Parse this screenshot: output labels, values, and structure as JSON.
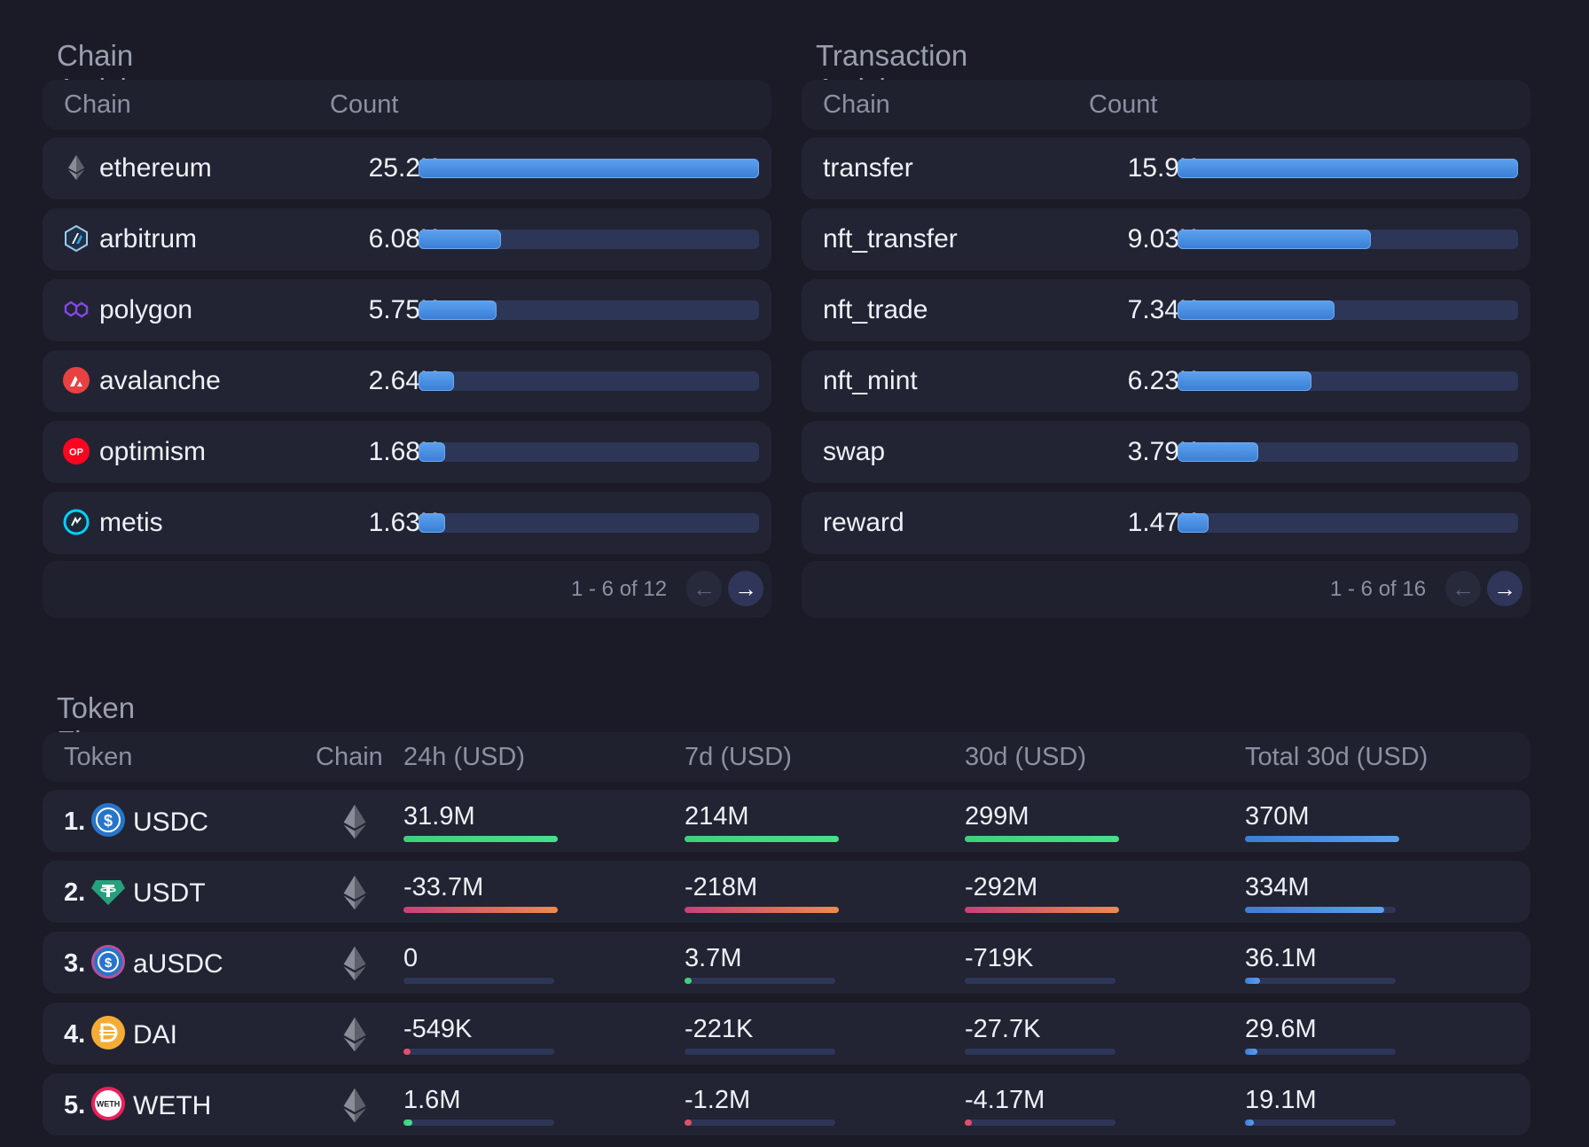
{
  "chain_activity": {
    "title": "Chain Activity",
    "headers": {
      "chain": "Chain",
      "count": "Count"
    },
    "rows": [
      {
        "name": "ethereum",
        "count": "25.2K",
        "share": 1.0,
        "icon": "ethereum-icon"
      },
      {
        "name": "arbitrum",
        "count": "6.08K",
        "share": 0.241,
        "icon": "arbitrum-icon"
      },
      {
        "name": "polygon",
        "count": "5.75K",
        "share": 0.228,
        "icon": "polygon-icon"
      },
      {
        "name": "avalanche",
        "count": "2.64K",
        "share": 0.105,
        "icon": "avalanche-icon"
      },
      {
        "name": "optimism",
        "count": "1.68K",
        "share": 0.067,
        "icon": "optimism-icon"
      },
      {
        "name": "metis",
        "count": "1.63K",
        "share": 0.065,
        "icon": "metis-icon"
      }
    ],
    "pagination": "1 - 6 of 12"
  },
  "transaction_activity": {
    "title": "Transaction Activity",
    "headers": {
      "chain": "Chain",
      "count": "Count"
    },
    "rows": [
      {
        "name": "transfer",
        "count": "15.9K",
        "share": 1.0
      },
      {
        "name": "nft_transfer",
        "count": "9.03K",
        "share": 0.568
      },
      {
        "name": "nft_trade",
        "count": "7.34K",
        "share": 0.462
      },
      {
        "name": "nft_mint",
        "count": "6.23K",
        "share": 0.392
      },
      {
        "name": "swap",
        "count": "3.79K",
        "share": 0.238
      },
      {
        "name": "reward",
        "count": "1.47K",
        "share": 0.092
      }
    ],
    "pagination": "1 - 6 of 16"
  },
  "token_flows": {
    "title": "Token Flows",
    "headers": {
      "token": "Token",
      "chain": "Chain",
      "d24": "24h (USD)",
      "d7": "7d (USD)",
      "d30": "30d (USD)",
      "total": "Total 30d (USD)"
    },
    "rows": [
      {
        "rank": "1.",
        "symbol": "USDC",
        "icon": "usdc-icon",
        "chain_icon": "ethereum-icon",
        "d24": "31.9M",
        "d24_share": 1.0,
        "d24_sign": "pos",
        "d7": "214M",
        "d7_share": 1.0,
        "d7_sign": "pos",
        "d30": "299M",
        "d30_share": 1.0,
        "d30_sign": "pos",
        "total": "370M",
        "total_share": 1.0
      },
      {
        "rank": "2.",
        "symbol": "USDT",
        "icon": "usdt-icon",
        "chain_icon": "ethereum-icon",
        "d24": "-33.7M",
        "d24_share": 1.0,
        "d24_sign": "neg",
        "d7": "-218M",
        "d7_share": 1.0,
        "d7_sign": "neg",
        "d30": "-292M",
        "d30_share": 1.0,
        "d30_sign": "neg",
        "total": "334M",
        "total_share": 0.9
      },
      {
        "rank": "3.",
        "symbol": "aUSDC",
        "icon": "ausdc-icon",
        "chain_icon": "ethereum-icon",
        "d24": "0",
        "d24_share": 0.0,
        "d24_sign": "pos",
        "d7": "3.7M",
        "d7_share": 0.03,
        "d7_sign": "pos",
        "d30": "-719K",
        "d30_share": 0.0,
        "d30_sign": "neg",
        "total": "36.1M",
        "total_share": 0.1
      },
      {
        "rank": "4.",
        "symbol": "DAI",
        "icon": "dai-icon",
        "chain_icon": "ethereum-icon",
        "d24": "-549K",
        "d24_share": 0.03,
        "d24_sign": "neg",
        "d7": "-221K",
        "d7_share": 0.0,
        "d7_sign": "neg",
        "d30": "-27.7K",
        "d30_share": 0.0,
        "d30_sign": "neg",
        "total": "29.6M",
        "total_share": 0.08
      },
      {
        "rank": "5.",
        "symbol": "WETH",
        "icon": "weth-icon",
        "chain_icon": "ethereum-icon",
        "d24": "1.6M",
        "d24_share": 0.06,
        "d24_sign": "pos",
        "d7": "-1.2M",
        "d7_share": 0.02,
        "d7_sign": "neg",
        "d30": "-4.17M",
        "d30_share": 0.02,
        "d30_sign": "neg",
        "total": "19.1M",
        "total_share": 0.06
      }
    ]
  },
  "colors": {
    "background": "#1a1b26",
    "bar_blue": "#4a8fe4",
    "positive": "#3fd07c",
    "negative": "#e0506a"
  }
}
